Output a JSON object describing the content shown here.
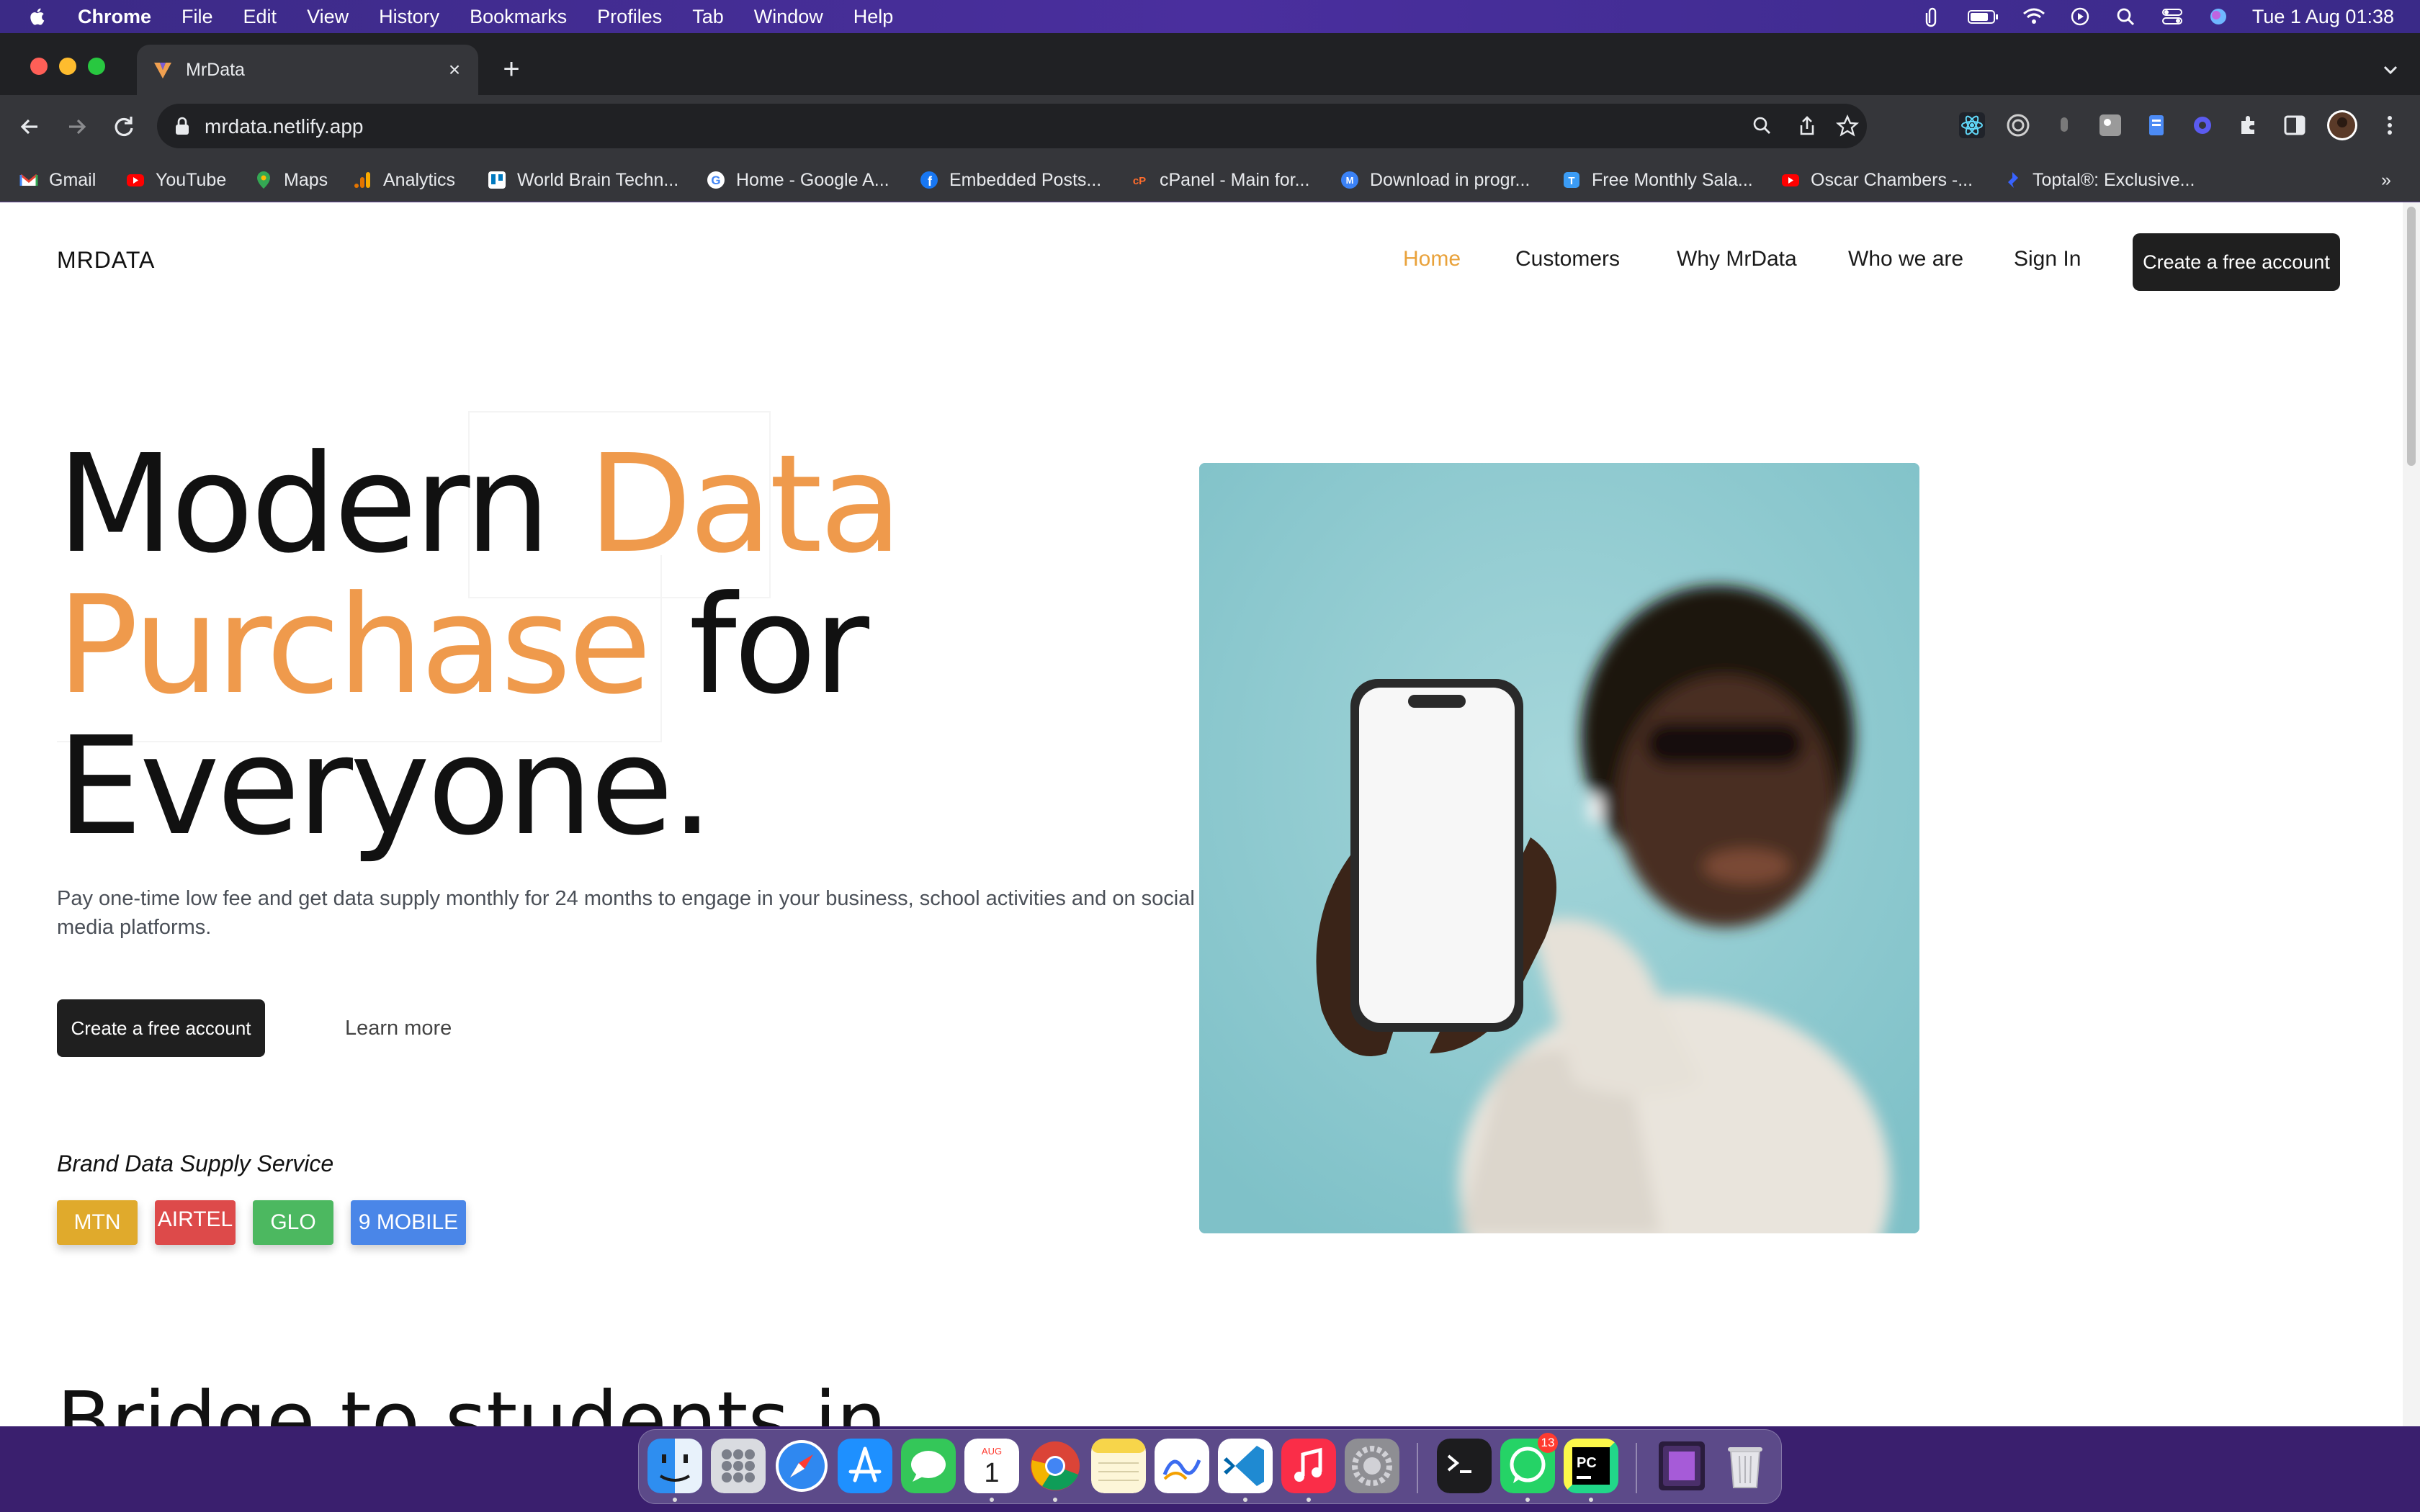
{
  "menubar": {
    "app": "Chrome",
    "items": [
      "File",
      "Edit",
      "View",
      "History",
      "Bookmarks",
      "Profiles",
      "Tab",
      "Window",
      "Help"
    ],
    "datetime": "Tue 1 Aug  01:38"
  },
  "browser": {
    "tab_title": "MrData",
    "url": "mrdata.netlify.app",
    "bookmarks": [
      {
        "label": "Gmail",
        "icon": "gmail-icon"
      },
      {
        "label": "YouTube",
        "icon": "youtube-icon"
      },
      {
        "label": "Maps",
        "icon": "maps-icon"
      },
      {
        "label": "Analytics",
        "icon": "analytics-icon"
      },
      {
        "label": "World Brain Techn...",
        "icon": "trello-icon"
      },
      {
        "label": "Home - Google A...",
        "icon": "google-icon"
      },
      {
        "label": "Embedded Posts...",
        "icon": "facebook-icon"
      },
      {
        "label": "cPanel - Main for...",
        "icon": "cpanel-icon"
      },
      {
        "label": "Download in progr...",
        "icon": "download-icon"
      },
      {
        "label": "Free Monthly Sala...",
        "icon": "t-icon"
      },
      {
        "label": "Oscar Chambers -...",
        "icon": "youtube-icon"
      },
      {
        "label": "Toptal®: Exclusive...",
        "icon": "toptal-icon"
      }
    ],
    "overflow": "»"
  },
  "site": {
    "logo": "MRDATA",
    "nav": [
      "Home",
      "Customers",
      "Why MrData",
      "Who we are",
      "Sign In"
    ],
    "cta_top": "Create a free account",
    "hero": {
      "w1": "Modern ",
      "w2": "Data",
      "w3": "Purchase",
      "w4": " for",
      "w5": "Everyone."
    },
    "description": "Pay one-time low fee and get data supply monthly for 24 months to engage in your business, school activities and on social media platforms.",
    "cta_primary": "Create a free account",
    "cta_secondary": "Learn more",
    "brand_title": "Brand Data Supply Service",
    "brands": [
      "MTN",
      "AIRTEL",
      "GLO",
      "9 MOBILE"
    ],
    "brand_colors": [
      "#e0aa2c",
      "#dd4a4a",
      "#4cb860",
      "#4a86e8"
    ],
    "next_heading": "Bridge to students in"
  },
  "dock": {
    "badge_count": "13",
    "calendar_month": "AUG",
    "calendar_day": "1"
  },
  "colors": {
    "accent": "#ef9a4c",
    "nav_active": "#e9a23b",
    "button_dark": "#1f1f1f"
  }
}
